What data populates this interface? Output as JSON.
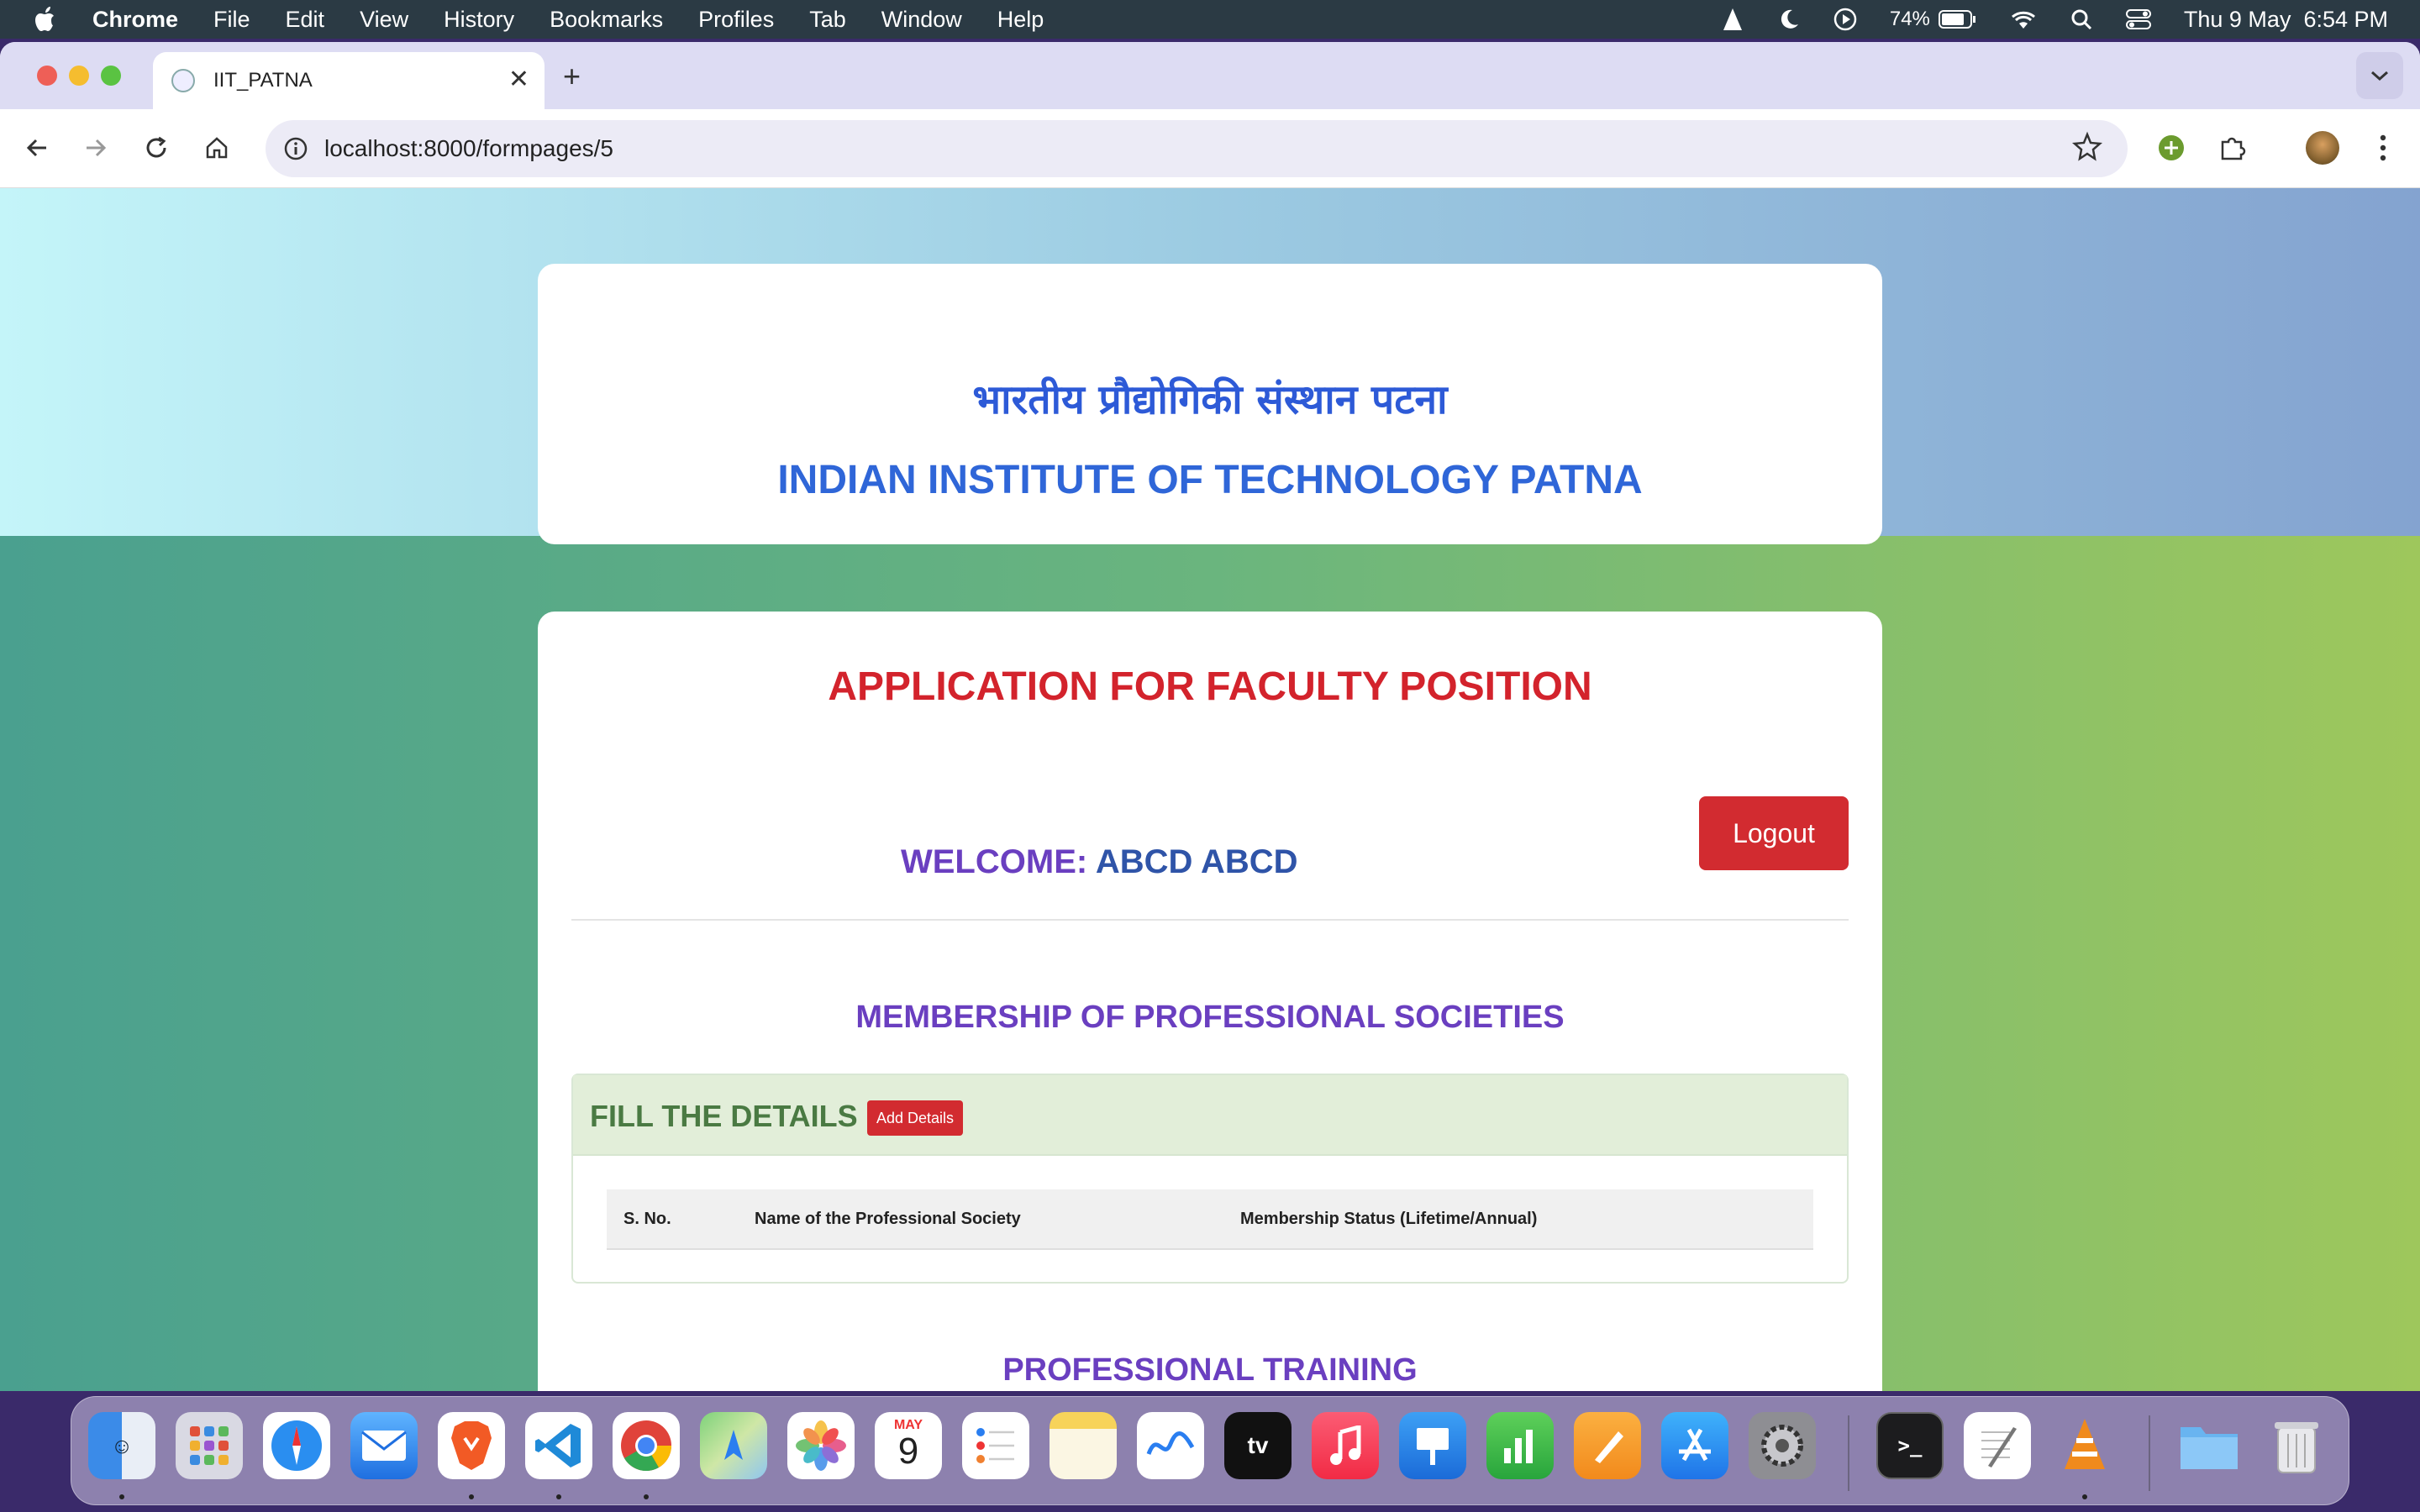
{
  "menubar": {
    "app": "Chrome",
    "items": [
      "File",
      "Edit",
      "View",
      "History",
      "Bookmarks",
      "Profiles",
      "Tab",
      "Window",
      "Help"
    ],
    "battery": "74%",
    "clock": "Thu 9 May  6:54 PM"
  },
  "browser": {
    "tab_title": "IIT_PATNA",
    "url": "localhost:8000/formpages/5"
  },
  "page": {
    "hindi_title": "भारतीय प्रौद्योगिकी संस्थान पटना",
    "english_title": "INDIAN INSTITUTE OF TECHNOLOGY PATNA",
    "app_title": "APPLICATION FOR FACULTY POSITION",
    "logout_label": "Logout",
    "welcome_label": "WELCOME: ",
    "welcome_name": "ABCD ABCD",
    "section1_title": "MEMBERSHIP OF PROFESSIONAL SOCIETIES",
    "fill_label": "FILL THE DETAILS",
    "add_details_label": "Add Details",
    "table_headers": [
      "S. No.",
      "Name of the Professional Society",
      "Membership Status (Lifetime/Annual)"
    ],
    "section2_title": "PROFESSIONAL TRAINING"
  },
  "dock": {
    "calendar_month": "MAY",
    "calendar_day": "9",
    "apps": [
      "finder-icon",
      "launchpad-icon",
      "safari-icon",
      "mail-icon",
      "brave-icon",
      "vscode-icon",
      "chrome-icon",
      "maps-icon",
      "photos-icon",
      "calendar-icon",
      "reminders-icon",
      "notes-icon",
      "freeform-icon",
      "appletv-icon",
      "music-icon",
      "keynote-icon",
      "numbers-icon",
      "pages-icon",
      "appstore-icon",
      "settings-icon",
      "terminal-icon",
      "textedit-icon",
      "vlc-icon",
      "folder-icon",
      "trash-icon"
    ]
  },
  "colors": {
    "accent_red": "#d22b30",
    "title_blue": "#2f66d8",
    "section_purple": "#6a3fc0"
  }
}
